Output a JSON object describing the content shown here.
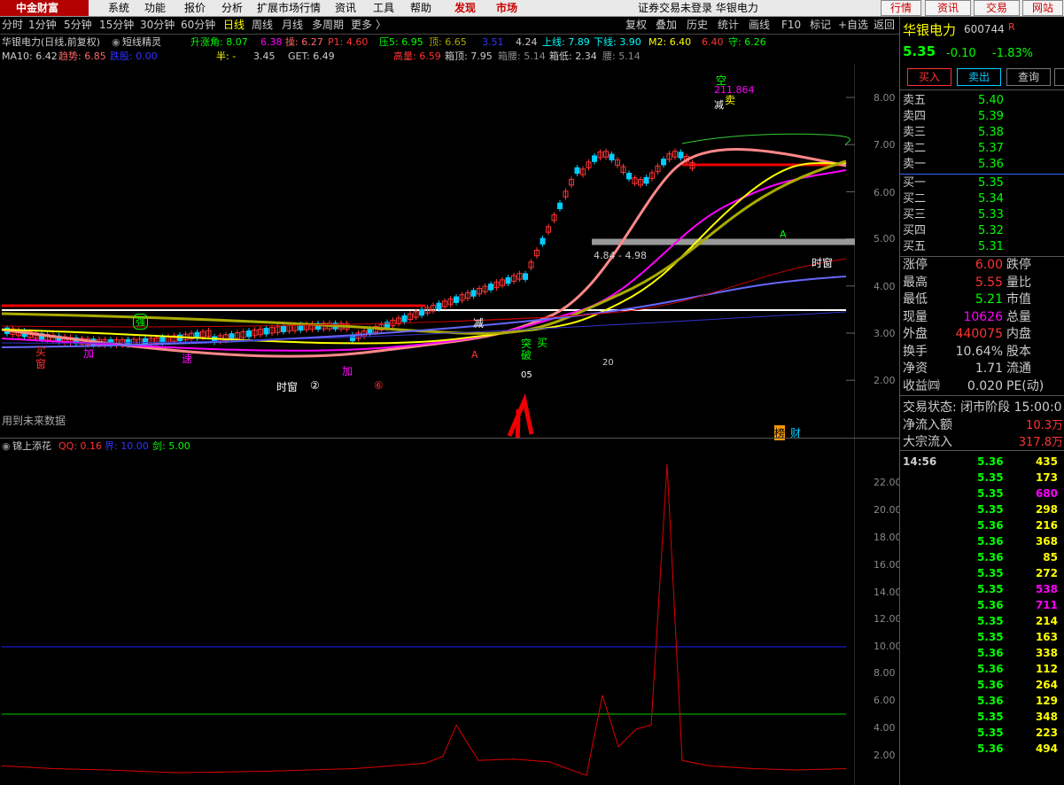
{
  "menubar": {
    "items": [
      "系统",
      "功能",
      "报价",
      "分析",
      "扩展市场行情",
      "资讯",
      "工具",
      "帮助"
    ],
    "highlight": [
      "发现",
      "市场"
    ],
    "status": "证券交易未登录  华银电力",
    "trade_buttons": [
      "行情",
      "资讯",
      "交易",
      "网站"
    ],
    "logo": "中金财富"
  },
  "periodbar": {
    "periods": [
      "分时",
      "1分钟",
      "5分钟",
      "15分钟",
      "30分钟",
      "60分钟",
      "日线",
      "周线",
      "月线",
      "多周期",
      "更多 〉"
    ],
    "active": "日线",
    "tools": [
      "复权",
      "叠加",
      "历史",
      "统计",
      "画线",
      "F10",
      "标记",
      "+自选",
      "返回"
    ]
  },
  "info": {
    "title": "华银电力(日线,前复权)",
    "indicator": "短线精灵",
    "items1": [
      "升涨角: 8.07",
      "6.38",
      "操: 6.27",
      "P1: 4.60",
      "压5: 6.95",
      "顶: 6.65",
      "3.51",
      "4.24",
      "上线: 7.89",
      "下线: 3.90",
      "M2: 6.40",
      "6.40",
      "守: 6.26"
    ],
    "items2": [
      "MA10: 6.42",
      "趋势: 6.85",
      "跌股: 0.00",
      "半: -",
      "3.45",
      "GET: 6.49",
      "高量: 6.59",
      "箱顶: 7.95",
      "箱腰: 5.14",
      "箱低: 2.34",
      "腰: 5.14"
    ]
  },
  "chart_labels": {
    "future_data": "用到未来数据",
    "price_anno": "211.864",
    "range_anno": "4.84 - 4.98",
    "time_window": "时窗",
    "time_window2": "时窗",
    "bang": "榜",
    "cai": "财",
    "sub_title": "锦上添花",
    "sub_items": [
      "QQ: 0.16",
      "界: 10.00",
      "剑: 5.00"
    ],
    "markers": [
      "买",
      "窗",
      "加",
      "速",
      "加",
      "突破",
      "买",
      "空",
      "减",
      "卖",
      "减",
      "A",
      "A",
      "05",
      "20",
      "②",
      "⑥",
      "强"
    ]
  },
  "main_yaxis": [
    "8.00",
    "7.00",
    "6.00",
    "5.00",
    "4.00",
    "3.00",
    "2.00"
  ],
  "sub_yaxis": [
    "22.00",
    "20.00",
    "18.00",
    "16.00",
    "14.00",
    "12.00",
    "10.00",
    "8.00",
    "6.00",
    "4.00",
    "2.00"
  ],
  "right_panel": {
    "name": "华银电力",
    "code": "600744",
    "r_mark": "R",
    "price": "5.35",
    "change": "-0.10",
    "change_pct": "-1.83%",
    "buttons": [
      "买入",
      "卖出",
      "查询"
    ],
    "sells": [
      [
        "卖五",
        "5.40"
      ],
      [
        "卖四",
        "5.39"
      ],
      [
        "卖三",
        "5.38"
      ],
      [
        "卖二",
        "5.37"
      ],
      [
        "卖一",
        "5.36"
      ]
    ],
    "buys": [
      [
        "买一",
        "5.35"
      ],
      [
        "买二",
        "5.34"
      ],
      [
        "买三",
        "5.33"
      ],
      [
        "买四",
        "5.32"
      ],
      [
        "买五",
        "5.31"
      ]
    ],
    "stats": [
      [
        "涨停",
        "6.00",
        "跌停",
        "#f33"
      ],
      [
        "最高",
        "5.55",
        "量比",
        "#f33"
      ],
      [
        "最低",
        "5.21",
        "市值",
        "#0f0"
      ],
      [
        "现量",
        "10626",
        "总量",
        "#f0f"
      ],
      [
        "外盘",
        "440075",
        "内盘",
        "#f33"
      ],
      [
        "换手",
        "10.64%",
        "股本",
        "#ccc"
      ],
      [
        "净资",
        "1.71",
        "流通",
        "#ccc"
      ],
      [
        "收益㈣",
        "0.020",
        "PE(动)",
        "#ccc"
      ]
    ],
    "trade_status": "交易状态: 闭市阶段 15:00:0",
    "net_inflow": [
      "净流入额",
      "10.3万"
    ],
    "block_inflow": [
      "大宗流入",
      "317.8万"
    ],
    "ticks": [
      [
        "14:56",
        "5.36",
        "435",
        "#ff0"
      ],
      [
        "",
        "5.35",
        "173",
        "#ff0"
      ],
      [
        "",
        "5.35",
        "680",
        "#f0f"
      ],
      [
        "",
        "5.35",
        "298",
        "#ff0"
      ],
      [
        "",
        "5.36",
        "216",
        "#ff0"
      ],
      [
        "",
        "5.36",
        "368",
        "#ff0"
      ],
      [
        "",
        "5.36",
        "85",
        "#ff0"
      ],
      [
        "",
        "5.35",
        "272",
        "#ff0"
      ],
      [
        "",
        "5.35",
        "538",
        "#f0f"
      ],
      [
        "",
        "5.36",
        "711",
        "#f0f"
      ],
      [
        "",
        "5.35",
        "214",
        "#ff0"
      ],
      [
        "",
        "5.35",
        "163",
        "#ff0"
      ],
      [
        "",
        "5.36",
        "338",
        "#ff0"
      ],
      [
        "",
        "5.36",
        "112",
        "#ff0"
      ],
      [
        "",
        "5.36",
        "264",
        "#ff0"
      ],
      [
        "",
        "5.36",
        "129",
        "#ff0"
      ],
      [
        "",
        "5.35",
        "348",
        "#ff0"
      ],
      [
        "",
        "5.35",
        "223",
        "#ff0"
      ],
      [
        "",
        "5.36",
        "494",
        "#ff0"
      ]
    ]
  }
}
